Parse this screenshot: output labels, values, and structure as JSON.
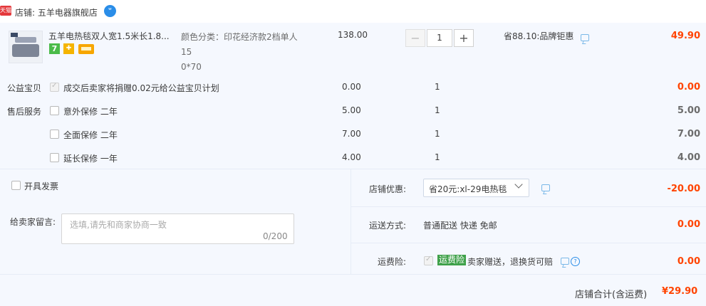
{
  "shop": {
    "badge": "天猫",
    "label": "店铺: 五羊电器旗舰店"
  },
  "item": {
    "title": "五羊电热毯双人宽1.5米长1.8...",
    "sku_line1": "颜色分类：印花经济款2档单人15",
    "sku_line2": "0*70",
    "price": "138.00",
    "quantity": "1",
    "minus": "−",
    "plus": "+",
    "promo": "省88.10:品牌钜惠",
    "total": "49.90",
    "badge_7": "7"
  },
  "charity": {
    "label": "公益宝贝",
    "text": "成交后卖家将捐赠0.02元给公益宝贝计划",
    "price": "0.00",
    "qty": "1",
    "total": "0.00"
  },
  "after_sales": {
    "label": "售后服务",
    "options": [
      {
        "name": "意外保修 二年",
        "price": "5.00",
        "qty": "1",
        "total": "5.00"
      },
      {
        "name": "全面保修 二年",
        "price": "7.00",
        "qty": "1",
        "total": "7.00"
      },
      {
        "name": "延长保修 一年",
        "price": "4.00",
        "qty": "1",
        "total": "4.00"
      }
    ]
  },
  "invoice": {
    "label": "开具发票"
  },
  "note": {
    "label": "给卖家留言:",
    "placeholder": "选填,请先和商家协商一致",
    "count": "0/200"
  },
  "coupon": {
    "label": "店铺优惠:",
    "selected": "省20元:xl-29电热毯",
    "amount": "-20.00"
  },
  "shipping": {
    "label": "运送方式:",
    "method": "普通配送 快递 免邮",
    "amount": "0.00"
  },
  "insurance": {
    "label": "运费险:",
    "tag": "运费险",
    "text": "卖家赠送，退换货可赔",
    "amount": "0.00",
    "help": "?"
  },
  "summary": {
    "label": "店铺合计(含运费)",
    "total": "¥29.90"
  },
  "colors": {
    "accent_red": "#f40",
    "panel_bg": "#f5f8fe",
    "tmall_red": "#e4393c",
    "insurance_green": "#3fa14a"
  },
  "icons": [
    "tmall-icon",
    "wangwang-icon",
    "message-icon",
    "chevron-down-icon",
    "help-icon",
    "check-icon"
  ]
}
